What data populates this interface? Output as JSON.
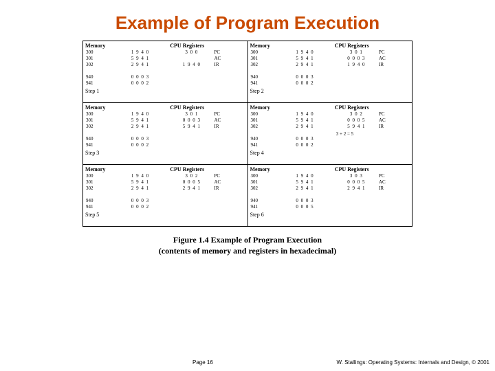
{
  "title": "Example of Program Execution",
  "caption_line1": "Figure 1.4 Example of Program Execution",
  "caption_line2": "(contents of memory and registers in hexadecimal)",
  "footer_page": "Page 16",
  "footer_credit": "W. Stallings: Operating Systems: Internals and Design, © 2001",
  "labels": {
    "mem": "Memory",
    "cpu": "CPU Registers",
    "pc": "PC",
    "ac": "AC",
    "ir": "IR",
    "step": "Step"
  },
  "steps": [
    {
      "n": "1",
      "mem_top": [
        [
          "300",
          "1 9 4 0"
        ],
        [
          "301",
          "5 9 4 1"
        ],
        [
          "302",
          "2 9 4 1"
        ]
      ],
      "mem_bot": [
        [
          "940",
          "0 0 0 3"
        ],
        [
          "941",
          "0 0 0 2"
        ]
      ],
      "reg": [
        [
          "3 0 0",
          "PC"
        ],
        [
          "",
          "AC"
        ],
        [
          "1 9 4 0",
          "IR"
        ]
      ],
      "note": ""
    },
    {
      "n": "2",
      "mem_top": [
        [
          "300",
          "1 9 4 0"
        ],
        [
          "301",
          "5 9 4 1"
        ],
        [
          "302",
          "2 9 4 1"
        ]
      ],
      "mem_bot": [
        [
          "940",
          "0 0 0 3"
        ],
        [
          "941",
          "0 0 0 2"
        ]
      ],
      "reg": [
        [
          "3 0 1",
          "PC"
        ],
        [
          "0 0 0 3",
          "AC"
        ],
        [
          "1 9 4 0",
          "IR"
        ]
      ],
      "note": ""
    },
    {
      "n": "3",
      "mem_top": [
        [
          "300",
          "1 9 4 0"
        ],
        [
          "301",
          "5 9 4 1"
        ],
        [
          "302",
          "2 9 4 1"
        ]
      ],
      "mem_bot": [
        [
          "940",
          "0 0 0 3"
        ],
        [
          "941",
          "0 0 0 2"
        ]
      ],
      "reg": [
        [
          "3 0 1",
          "PC"
        ],
        [
          "0 0 0 3",
          "AC"
        ],
        [
          "5 9 4 1",
          "IR"
        ]
      ],
      "note": ""
    },
    {
      "n": "4",
      "mem_top": [
        [
          "300",
          "1 9 4 0"
        ],
        [
          "301",
          "5 9 4 1"
        ],
        [
          "302",
          "2 9 4 1"
        ]
      ],
      "mem_bot": [
        [
          "940",
          "0 0 0 3"
        ],
        [
          "941",
          "0 0 0 2"
        ]
      ],
      "reg": [
        [
          "3 0 2",
          "PC"
        ],
        [
          "0 0 0 5",
          "AC"
        ],
        [
          "5 9 4 1",
          "IR"
        ]
      ],
      "note": "3 + 2 = 5"
    },
    {
      "n": "5",
      "mem_top": [
        [
          "300",
          "1 9 4 0"
        ],
        [
          "301",
          "5 9 4 1"
        ],
        [
          "302",
          "2 9 4 1"
        ]
      ],
      "mem_bot": [
        [
          "940",
          "0 0 0 3"
        ],
        [
          "941",
          "0 0 0 2"
        ]
      ],
      "reg": [
        [
          "3 0 2",
          "PC"
        ],
        [
          "0 0 0 5",
          "AC"
        ],
        [
          "2 9 4 1",
          "IR"
        ]
      ],
      "note": ""
    },
    {
      "n": "6",
      "mem_top": [
        [
          "300",
          "1 9 4 0"
        ],
        [
          "301",
          "5 9 4 1"
        ],
        [
          "302",
          "2 9 4 1"
        ]
      ],
      "mem_bot": [
        [
          "940",
          "0 0 0 3"
        ],
        [
          "941",
          "0 0 0 5"
        ]
      ],
      "reg": [
        [
          "3 0 3",
          "PC"
        ],
        [
          "0 0 0 5",
          "AC"
        ],
        [
          "2 9 4 1",
          "IR"
        ]
      ],
      "note": ""
    }
  ]
}
